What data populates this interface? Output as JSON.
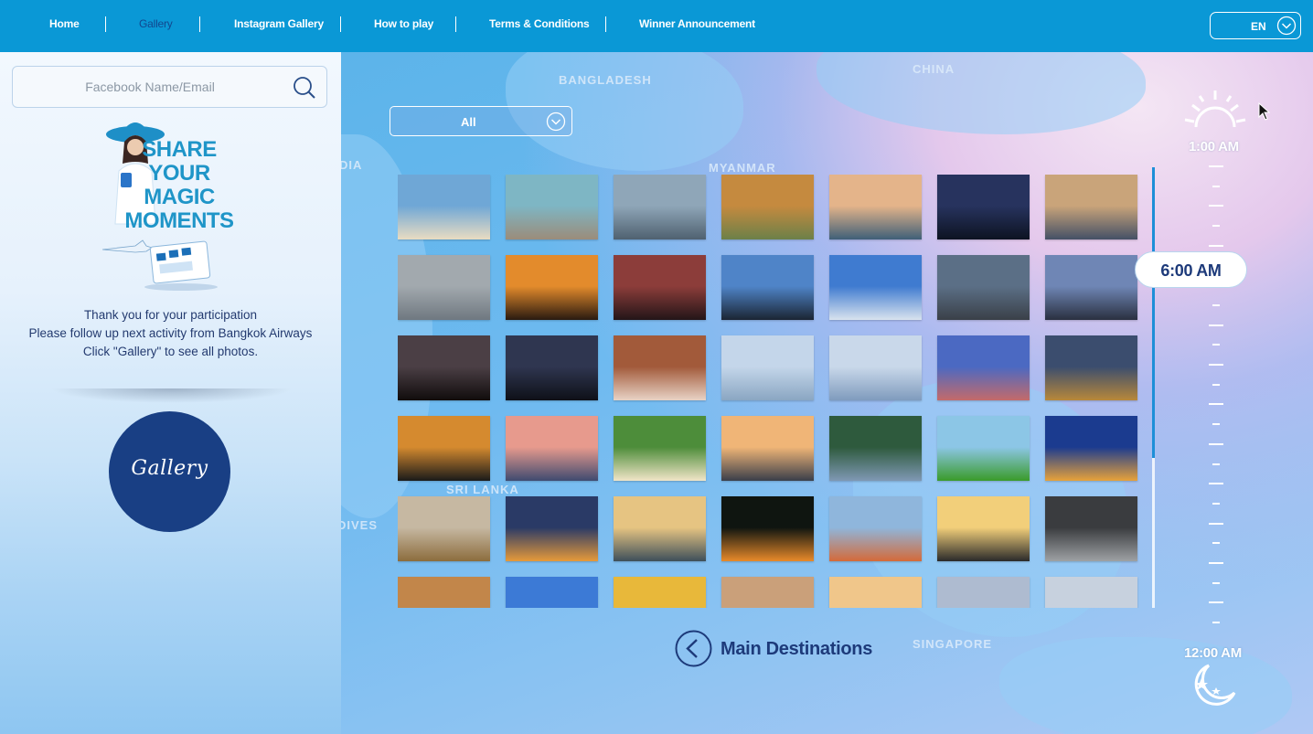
{
  "nav": {
    "items": [
      {
        "label": "Home",
        "active": false
      },
      {
        "label": "Gallery",
        "active": true
      },
      {
        "label": "Instagram Gallery",
        "active": false
      },
      {
        "label": "How to play",
        "active": false
      },
      {
        "label": "Terms & Conditions",
        "active": false
      },
      {
        "label": "Winner Announcement",
        "active": false
      }
    ],
    "language": "EN"
  },
  "sidebar": {
    "search_placeholder": "Facebook Name/Email",
    "promo_headline": [
      "SHARE",
      "YOUR",
      "MAGIC",
      "MOMENTS"
    ],
    "thanks_lines": [
      "Thank you for your participation",
      "Please follow up next activity from Bangkok Airways",
      "Click \"Gallery\" to see all photos."
    ],
    "gallery_button": "Gallery"
  },
  "main": {
    "map_labels": [
      "BANGLADESH",
      "CHINA",
      "MYANMAR",
      "DIA",
      "SRI LANKA",
      "DIVES",
      "SINGAPORE"
    ],
    "filter_value": "All",
    "back_link": "Main Destinations",
    "time": {
      "start": "1:00 AM",
      "current": "6:00 AM",
      "end": "12:00 AM"
    },
    "photos": [
      [
        "#6fa7d6",
        "#e9dcc2"
      ],
      [
        "#7eb6c4",
        "#9b8c7a"
      ],
      [
        "#8fa6b8",
        "#4f6170"
      ],
      [
        "#c58a3f",
        "#6c8048"
      ],
      [
        "#e4b48a",
        "#3f5f78"
      ],
      [
        "#27335e",
        "#0d1322"
      ],
      [
        "#c9a47a",
        "#445066"
      ],
      [
        "#a2a9ae",
        "#6f7880"
      ],
      [
        "#e38b2c",
        "#2a1a10"
      ],
      [
        "#8c3d3a",
        "#231518"
      ],
      [
        "#4f84c8",
        "#1b2533"
      ],
      [
        "#3f7bd0",
        "#d9e3ee"
      ],
      [
        "#5b6f86",
        "#3a4048"
      ],
      [
        "#6f86b5",
        "#2a3040"
      ],
      [
        "#4b3f45",
        "#100c0c"
      ],
      [
        "#2f3650",
        "#0e1018"
      ],
      [
        "#a25a3a",
        "#e8d3c6"
      ],
      [
        "#c4d6ea",
        "#8aa6c2"
      ],
      [
        "#c9d8ea",
        "#7f9bbd"
      ],
      [
        "#4b69c2",
        "#c46a6a"
      ],
      [
        "#3b4d6e",
        "#b8883a"
      ],
      [
        "#d58a2f",
        "#1a1a1a"
      ],
      [
        "#e79a8d",
        "#3f4a70"
      ],
      [
        "#4d8d3a",
        "#f1e5c8"
      ],
      [
        "#f0b577",
        "#3a3e4a"
      ],
      [
        "#2e5a3d",
        "#7f98b4"
      ],
      [
        "#8cc6e6",
        "#3a9b2a"
      ],
      [
        "#1b3b8f",
        "#e7a23a"
      ],
      [
        "#c6b8a2",
        "#8c6d3d"
      ],
      [
        "#2a3a66",
        "#e69a3a"
      ],
      [
        "#e6c482",
        "#3e4f5a"
      ],
      [
        "#0f1510",
        "#e88a2a"
      ],
      [
        "#8fb6dc",
        "#d46a3a"
      ],
      [
        "#f2cf7a",
        "#2a2a2a"
      ],
      [
        "#3a3c3f",
        "#9ea1a4"
      ],
      [
        "#c2864a",
        "#9e5a30"
      ],
      [
        "#3c7ad6",
        "#bcd6f0"
      ],
      [
        "#e8b83a",
        "#6a5a2a"
      ],
      [
        "#caa07a",
        "#2a2420"
      ],
      [
        "#f0c68a",
        "#4a5a3a"
      ],
      [
        "#aebbd0",
        "#5d6e88"
      ],
      [
        "#c7d1de",
        "#e9eef3"
      ]
    ]
  }
}
